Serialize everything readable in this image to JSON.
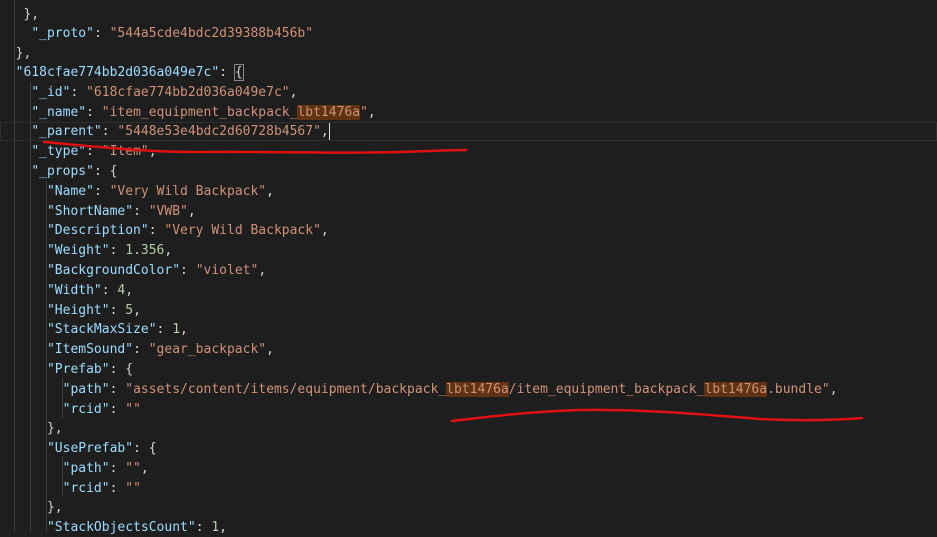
{
  "code": {
    "l01": {
      "brace": "},"
    },
    "l02": {
      "key": "\"_proto\"",
      "colon": ": ",
      "value": "\"544a5cde4bdc2d39388b456b\""
    },
    "l03": {
      "brace": "},"
    },
    "l04": {
      "key": "\"618cfae774bb2d036a049e7c\"",
      "colon": ": ",
      "brace": "{"
    },
    "l05": {
      "key": "\"_id\"",
      "colon": ": ",
      "value": "\"618cfae774bb2d036a049e7c\"",
      "comma": ","
    },
    "l06": {
      "key": "\"_name\"",
      "colon": ": ",
      "value_a": "\"item_equipment_backpack_",
      "value_hl": "lbt1476a",
      "value_b": "\"",
      "comma": ","
    },
    "l07": {
      "key": "\"_parent\"",
      "colon": ": ",
      "value": "\"5448e53e4bdc2d60728b4567\"",
      "comma": ","
    },
    "l08": {
      "key": "\"_type\"",
      "colon": ": ",
      "value": "\"Item\"",
      "comma": ","
    },
    "l09": {
      "key": "\"_props\"",
      "colon": ": ",
      "brace": "{"
    },
    "l10": {
      "key": "\"Name\"",
      "colon": ": ",
      "value": "\"Very Wild Backpack\"",
      "comma": ","
    },
    "l11": {
      "key": "\"ShortName\"",
      "colon": ": ",
      "value": "\"VWB\"",
      "comma": ","
    },
    "l12": {
      "key": "\"Description\"",
      "colon": ": ",
      "value": "\"Very Wild Backpack\"",
      "comma": ","
    },
    "l13": {
      "key": "\"Weight\"",
      "colon": ": ",
      "value": "1.356",
      "comma": ","
    },
    "l14": {
      "key": "\"BackgroundColor\"",
      "colon": ": ",
      "value": "\"violet\"",
      "comma": ","
    },
    "l15": {
      "key": "\"Width\"",
      "colon": ": ",
      "value": "4",
      "comma": ","
    },
    "l16": {
      "key": "\"Height\"",
      "colon": ": ",
      "value": "5",
      "comma": ","
    },
    "l17": {
      "key": "\"StackMaxSize\"",
      "colon": ": ",
      "value": "1",
      "comma": ","
    },
    "l18": {
      "key": "\"ItemSound\"",
      "colon": ": ",
      "value": "\"gear_backpack\"",
      "comma": ","
    },
    "l19": {
      "key": "\"Prefab\"",
      "colon": ": ",
      "brace": "{"
    },
    "l20": {
      "key": "\"path\"",
      "colon": ": ",
      "value_a": "\"assets/content/items/equipment/backpack_",
      "value_hl1": "lbt1476a",
      "value_b": "/item_equipment_backpack_",
      "value_hl2": "lbt1476a",
      "value_c": ".bundle\"",
      "comma": ","
    },
    "l21": {
      "key": "\"rcid\"",
      "colon": ": ",
      "value": "\"\""
    },
    "l22": {
      "brace": "},"
    },
    "l23": {
      "key": "\"UsePrefab\"",
      "colon": ": ",
      "brace": "{"
    },
    "l24": {
      "key": "\"path\"",
      "colon": ": ",
      "value": "\"\"",
      "comma": ","
    },
    "l25": {
      "key": "\"rcid\"",
      "colon": ": ",
      "value": "\"\""
    },
    "l26": {
      "brace": "},"
    },
    "l27": {
      "key": "\"StackObjectsCount\"",
      "colon": ": ",
      "value": "1",
      "comma": ","
    }
  },
  "colors": {
    "background": "#1e1e1e",
    "key": "#9cdcfe",
    "string": "#ce9178",
    "number": "#b5cea8",
    "find_highlight": "#613214",
    "annotation_stroke": "#e01010"
  }
}
